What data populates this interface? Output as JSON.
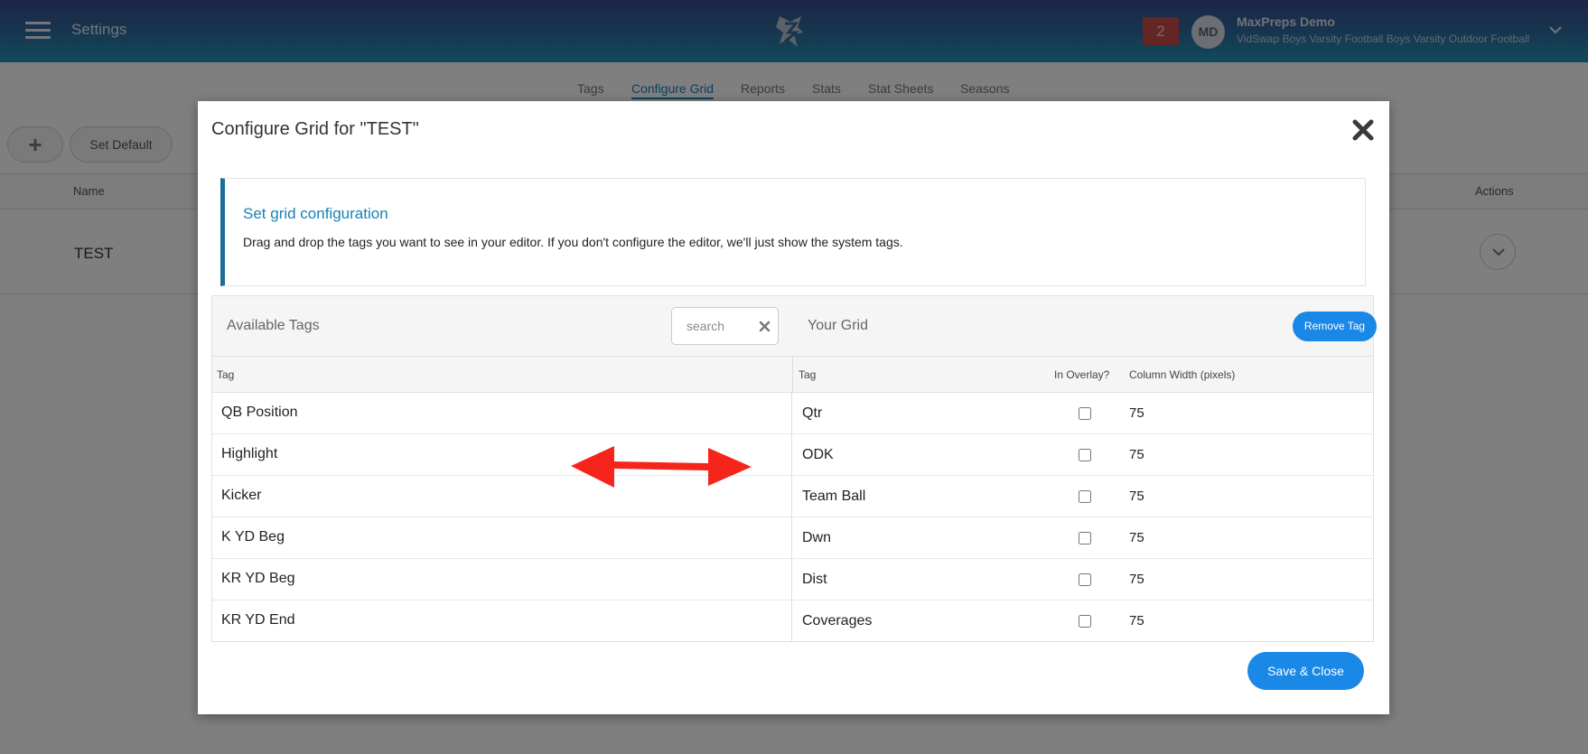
{
  "header": {
    "title": "Settings",
    "notification_count": "2",
    "user_initials": "MD",
    "user_name": "MaxPreps Demo",
    "user_team": "VidSwap Boys Varsity Football Boys Varsity Outdoor Football"
  },
  "tabs": [
    {
      "label": "Tags",
      "active": false
    },
    {
      "label": "Configure Grid",
      "active": true
    },
    {
      "label": "Reports",
      "active": false
    },
    {
      "label": "Stats",
      "active": false
    },
    {
      "label": "Stat Sheets",
      "active": false
    },
    {
      "label": "Seasons",
      "active": false
    }
  ],
  "toolbar": {
    "add_label": "+",
    "set_default_label": "Set Default"
  },
  "background_table": {
    "name_header": "Name",
    "actions_header": "Actions",
    "rows": [
      {
        "name": "TEST"
      }
    ]
  },
  "modal": {
    "title": "Configure Grid for \"TEST\"",
    "callout_title": "Set grid configuration",
    "callout_text": "Drag and drop the tags you want to see in your editor. If you don't configure the editor, we'll just show the system tags.",
    "available_tags_label": "Available Tags",
    "search_placeholder": "search",
    "your_grid_label": "Your Grid",
    "remove_tag_label": "Remove Tag",
    "columns": {
      "left_tag": "Tag",
      "right_tag": "Tag",
      "in_overlay": "In Overlay?",
      "column_width": "Column Width (pixels)"
    },
    "available_tags": [
      {
        "name": "QB Position"
      },
      {
        "name": "Highlight"
      },
      {
        "name": "Kicker"
      },
      {
        "name": "K YD Beg"
      },
      {
        "name": "KR YD Beg"
      },
      {
        "name": "KR YD End"
      }
    ],
    "grid_tags": [
      {
        "name": "Qtr",
        "in_overlay": false,
        "width": "75"
      },
      {
        "name": "ODK",
        "in_overlay": false,
        "width": "75"
      },
      {
        "name": "Team Ball",
        "in_overlay": false,
        "width": "75"
      },
      {
        "name": "Dwn",
        "in_overlay": false,
        "width": "75"
      },
      {
        "name": "Dist",
        "in_overlay": false,
        "width": "75"
      },
      {
        "name": "Coverages",
        "in_overlay": false,
        "width": "75"
      }
    ],
    "save_label": "Save & Close"
  },
  "colors": {
    "accent": "#1a88e6",
    "link": "#1a7fb5",
    "notification": "#c94b4b",
    "arrow": "#f5251c"
  },
  "icons": [
    "hamburger-icon",
    "logo-icon",
    "chevron-down-icon",
    "close-icon",
    "clear-icon",
    "double-arrow-icon"
  ]
}
